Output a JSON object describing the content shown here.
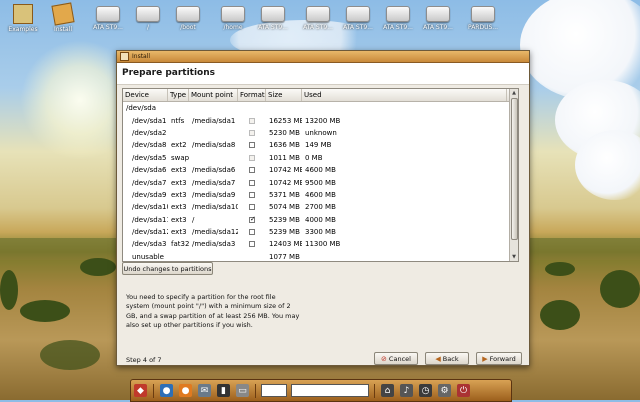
{
  "desktop_icons": [
    {
      "label": "Examples",
      "kind": "folder"
    },
    {
      "label": "Install",
      "kind": "package"
    },
    {
      "label": "ATA ST9...",
      "kind": "drive"
    },
    {
      "label": "/",
      "kind": "drive"
    },
    {
      "label": "/boot",
      "kind": "drive"
    },
    {
      "label": "/home",
      "kind": "drive"
    },
    {
      "label": "ATA ST9...",
      "kind": "drive"
    },
    {
      "label": "ATA ST9...",
      "kind": "drive"
    },
    {
      "label": "ATA ST9...",
      "kind": "drive"
    },
    {
      "label": "ATA ST9...",
      "kind": "drive"
    },
    {
      "label": "ATA ST9...",
      "kind": "drive"
    },
    {
      "label": "PARDUS...",
      "kind": "drive"
    }
  ],
  "window": {
    "title": "Install",
    "heading": "Prepare partitions"
  },
  "table": {
    "columns": [
      "Device",
      "Type",
      "Mount point",
      "Format?",
      "Size",
      "Used"
    ],
    "rows": [
      {
        "device": "/dev/sda",
        "type": "",
        "mount": "",
        "format": "none",
        "size": "",
        "used": "",
        "top": true
      },
      {
        "device": "/dev/sda1",
        "type": "ntfs",
        "mount": "/media/sda1",
        "format": "disabled",
        "size": "16253 MB",
        "used": "13200 MB"
      },
      {
        "device": "/dev/sda2",
        "type": "",
        "mount": "",
        "format": "disabled",
        "size": "5230 MB",
        "used": "unknown"
      },
      {
        "device": "/dev/sda8",
        "type": "ext2",
        "mount": "/media/sda8",
        "format": "unchecked",
        "size": "1636 MB",
        "used": "149 MB"
      },
      {
        "device": "/dev/sda5",
        "type": "swap",
        "mount": "",
        "format": "disabled",
        "size": "1011 MB",
        "used": "0 MB"
      },
      {
        "device": "/dev/sda6",
        "type": "ext3",
        "mount": "/media/sda6",
        "format": "unchecked",
        "size": "10742 MB",
        "used": "4600 MB"
      },
      {
        "device": "/dev/sda7",
        "type": "ext3",
        "mount": "/media/sda7",
        "format": "unchecked",
        "size": "10742 MB",
        "used": "9500 MB"
      },
      {
        "device": "/dev/sda9",
        "type": "ext3",
        "mount": "/media/sda9",
        "format": "unchecked",
        "size": "5371 MB",
        "used": "4600 MB"
      },
      {
        "device": "/dev/sda10",
        "type": "ext3",
        "mount": "/media/sda10",
        "format": "unchecked",
        "size": "5074 MB",
        "used": "2700 MB"
      },
      {
        "device": "/dev/sda11",
        "type": "ext3",
        "mount": "/",
        "format": "checked",
        "size": "5239 MB",
        "used": "4000 MB"
      },
      {
        "device": "/dev/sda12",
        "type": "ext3",
        "mount": "/media/sda12",
        "format": "unchecked",
        "size": "5239 MB",
        "used": "3300 MB"
      },
      {
        "device": "/dev/sda3",
        "type": "fat32",
        "mount": "/media/sda3",
        "format": "unchecked",
        "size": "12403 MB",
        "used": "11300 MB"
      },
      {
        "device": "unusable",
        "type": "",
        "mount": "",
        "format": "none",
        "size": "1077 MB",
        "used": ""
      }
    ]
  },
  "undo_button": "Undo changes to partitions",
  "info_text": "You need to specify a partition for the root file system (mount point \"/\") with a minimum size of 2 GB, and a swap partition of at least 256 MB. You may also set up other partitions if you wish.",
  "step_text": "Step 4 of 7",
  "buttons": {
    "cancel": "Cancel",
    "back": "Back",
    "forward": "Forward"
  }
}
